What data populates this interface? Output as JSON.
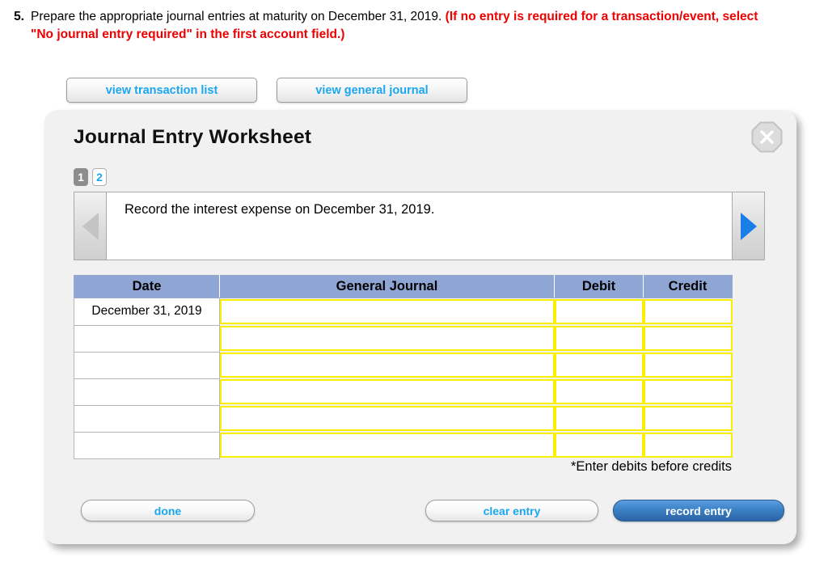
{
  "question": {
    "number": "5.",
    "text_plain": "Prepare the appropriate journal entries at maturity on December 31, 2019.",
    "text_red": "(If no entry is required for a transaction/event, select \"No journal entry required\" in the first account field.)",
    "red_color": "#ee0000"
  },
  "toolbar": {
    "view_transaction_list": "view transaction list",
    "view_general_journal": "view general journal",
    "link_color": "#1aa7f0"
  },
  "panel": {
    "title": "Journal Entry Worksheet",
    "close_icon": "close-x-icon",
    "background": "#f1f1f1"
  },
  "page_tabs": [
    {
      "label": "1",
      "active": true
    },
    {
      "label": "2",
      "active": false
    }
  ],
  "instruction": {
    "prev_icon": "triangle-left-icon",
    "next_icon": "triangle-right-icon",
    "prev_enabled": false,
    "next_enabled": true,
    "prev_color": "#c4c4c4",
    "next_color": "#1a7ee8",
    "text": "Record the interest expense on December 31, 2019."
  },
  "journal_table": {
    "header_color": "#8fa5d4",
    "field_border_color": "#f8f000",
    "columns": [
      "Date",
      "General Journal",
      "Debit",
      "Credit"
    ],
    "rows": [
      {
        "date": "December 31, 2019",
        "general_journal": "",
        "debit": "",
        "credit": ""
      },
      {
        "date": "",
        "general_journal": "",
        "debit": "",
        "credit": ""
      },
      {
        "date": "",
        "general_journal": "",
        "debit": "",
        "credit": ""
      },
      {
        "date": "",
        "general_journal": "",
        "debit": "",
        "credit": ""
      },
      {
        "date": "",
        "general_journal": "",
        "debit": "",
        "credit": ""
      },
      {
        "date": "",
        "general_journal": "",
        "debit": "",
        "credit": ""
      }
    ],
    "note": "*Enter debits before credits"
  },
  "footer": {
    "done": "done",
    "clear_entry": "clear entry",
    "record_entry": "record entry",
    "record_entry_color": "#3a7fc4"
  }
}
